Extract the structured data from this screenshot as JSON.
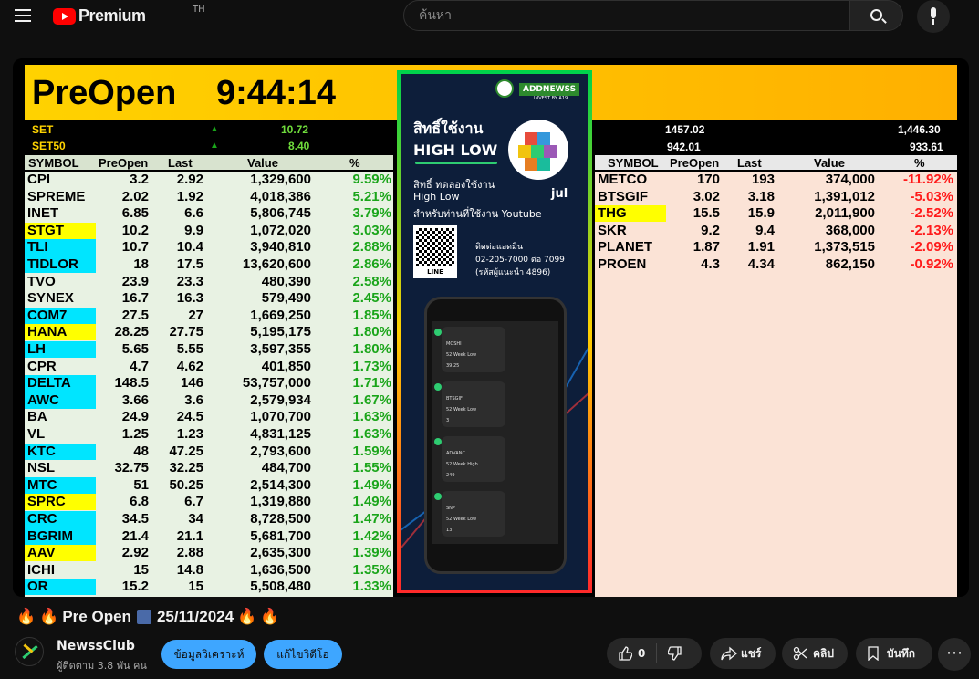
{
  "header": {
    "logo_text": "Premium",
    "logo_region": "TH",
    "search_placeholder": "ค้นหา"
  },
  "video": {
    "banner": {
      "title": "PreOpen",
      "time": "9:44:14"
    },
    "indices_left": [
      {
        "name": "SET",
        "value": "10.72"
      },
      {
        "name": "SET50",
        "value": "8.40"
      }
    ],
    "indices_right": [
      {
        "a": "1457.02",
        "b": "1,446.30"
      },
      {
        "a": "942.01",
        "b": "933.61"
      }
    ],
    "columns": [
      "SYMBOL",
      "PreOpen",
      "Last",
      "Value",
      "%"
    ],
    "gainers": [
      {
        "sym": "CPI",
        "po": "3.2",
        "last": "2.92",
        "val": "1,329,600",
        "pct": "9.59%",
        "hl": ""
      },
      {
        "sym": "SPREME",
        "po": "2.02",
        "last": "1.92",
        "val": "4,018,386",
        "pct": "5.21%",
        "hl": ""
      },
      {
        "sym": "INET",
        "po": "6.85",
        "last": "6.6",
        "val": "5,806,745",
        "pct": "3.79%",
        "hl": ""
      },
      {
        "sym": "STGT",
        "po": "10.2",
        "last": "9.9",
        "val": "1,072,020",
        "pct": "3.03%",
        "hl": "yellow"
      },
      {
        "sym": "TLI",
        "po": "10.7",
        "last": "10.4",
        "val": "3,940,810",
        "pct": "2.88%",
        "hl": "cyan"
      },
      {
        "sym": "TIDLOR",
        "po": "18",
        "last": "17.5",
        "val": "13,620,600",
        "pct": "2.86%",
        "hl": "cyan"
      },
      {
        "sym": "TVO",
        "po": "23.9",
        "last": "23.3",
        "val": "480,390",
        "pct": "2.58%",
        "hl": ""
      },
      {
        "sym": "SYNEX",
        "po": "16.7",
        "last": "16.3",
        "val": "579,490",
        "pct": "2.45%",
        "hl": ""
      },
      {
        "sym": "COM7",
        "po": "27.5",
        "last": "27",
        "val": "1,669,250",
        "pct": "1.85%",
        "hl": "cyan"
      },
      {
        "sym": "HANA",
        "po": "28.25",
        "last": "27.75",
        "val": "5,195,175",
        "pct": "1.80%",
        "hl": "yellow"
      },
      {
        "sym": "LH",
        "po": "5.65",
        "last": "5.55",
        "val": "3,597,355",
        "pct": "1.80%",
        "hl": "cyan"
      },
      {
        "sym": "CPR",
        "po": "4.7",
        "last": "4.62",
        "val": "401,850",
        "pct": "1.73%",
        "hl": ""
      },
      {
        "sym": "DELTA",
        "po": "148.5",
        "last": "146",
        "val": "53,757,000",
        "pct": "1.71%",
        "hl": "cyan"
      },
      {
        "sym": "AWC",
        "po": "3.66",
        "last": "3.6",
        "val": "2,579,934",
        "pct": "1.67%",
        "hl": "cyan"
      },
      {
        "sym": "BA",
        "po": "24.9",
        "last": "24.5",
        "val": "1,070,700",
        "pct": "1.63%",
        "hl": ""
      },
      {
        "sym": "VL",
        "po": "1.25",
        "last": "1.23",
        "val": "4,831,125",
        "pct": "1.63%",
        "hl": ""
      },
      {
        "sym": "KTC",
        "po": "48",
        "last": "47.25",
        "val": "2,793,600",
        "pct": "1.59%",
        "hl": "cyan"
      },
      {
        "sym": "NSL",
        "po": "32.75",
        "last": "32.25",
        "val": "484,700",
        "pct": "1.55%",
        "hl": ""
      },
      {
        "sym": "MTC",
        "po": "51",
        "last": "50.25",
        "val": "2,514,300",
        "pct": "1.49%",
        "hl": "cyan"
      },
      {
        "sym": "SPRC",
        "po": "6.8",
        "last": "6.7",
        "val": "1,319,880",
        "pct": "1.49%",
        "hl": "yellow"
      },
      {
        "sym": "CRC",
        "po": "34.5",
        "last": "34",
        "val": "8,728,500",
        "pct": "1.47%",
        "hl": "cyan"
      },
      {
        "sym": "BGRIM",
        "po": "21.4",
        "last": "21.1",
        "val": "5,681,700",
        "pct": "1.42%",
        "hl": "cyan"
      },
      {
        "sym": "AAV",
        "po": "2.92",
        "last": "2.88",
        "val": "2,635,300",
        "pct": "1.39%",
        "hl": "yellow"
      },
      {
        "sym": "ICHI",
        "po": "15",
        "last": "14.8",
        "val": "1,636,500",
        "pct": "1.35%",
        "hl": ""
      },
      {
        "sym": "OR",
        "po": "15.2",
        "last": "15",
        "val": "5,508,480",
        "pct": "1.33%",
        "hl": "cyan"
      }
    ],
    "losers": [
      {
        "sym": "METCO",
        "po": "170",
        "last": "193",
        "val": "374,000",
        "pct": "-11.92%",
        "hl": ""
      },
      {
        "sym": "BTSGIF",
        "po": "3.02",
        "last": "3.18",
        "val": "1,391,012",
        "pct": "-5.03%",
        "hl": ""
      },
      {
        "sym": "THG",
        "po": "15.5",
        "last": "15.9",
        "val": "2,011,900",
        "pct": "-2.52%",
        "hl": "yellow"
      },
      {
        "sym": "SKR",
        "po": "9.2",
        "last": "9.4",
        "val": "368,000",
        "pct": "-2.13%",
        "hl": ""
      },
      {
        "sym": "PLANET",
        "po": "1.87",
        "last": "1.91",
        "val": "1,373,515",
        "pct": "-2.09%",
        "hl": ""
      },
      {
        "sym": "PROEN",
        "po": "4.3",
        "last": "4.34",
        "val": "862,150",
        "pct": "-0.92%",
        "hl": ""
      }
    ],
    "ad": {
      "badge": "ADDNEWSS",
      "badge_sub": "INVEST BY A19",
      "h1": "สิทธิ์ใช้งาน",
      "h2": "HIGH LOW",
      "p1": "สิทธิ์ ทดลองใช้งาน",
      "p2": "High Low",
      "p3": "สำหรับท่านที่ใช้งาน Youtube",
      "jul": "jul",
      "qr_label": "LINE",
      "contact1": "ติดต่อแอดมิน",
      "contact2": "02-205-7000 ต่อ 7099",
      "contact3": "(รหัสผู้แนะนำ 4896)",
      "chats": [
        {
          "t1": "MOSHI",
          "t2": "52 Week Low",
          "t3": "39.25"
        },
        {
          "t1": "BTSGIF",
          "t2": "52 Week Low",
          "t3": "3"
        },
        {
          "t1": "ADVANC",
          "t2": "52 Week High",
          "t3": "249"
        },
        {
          "t1": "SNP",
          "t2": "52 Week Low",
          "t3": "13"
        }
      ]
    }
  },
  "details": {
    "title_text": "Pre Open",
    "title_date": "25/11/2024",
    "channel_name": "NewssClub",
    "channel_subs": "ผู้ติดตาม 3.8 พัน คน",
    "btn_analysis": "ข้อมูลวิเคราะห์",
    "btn_edit": "แก้ไขวิดีโอ",
    "likes": "0",
    "share": "แชร์",
    "clip": "คลิป",
    "save": "บันทึก",
    "more": "⋯"
  },
  "colors": {
    "up": "#1aa51a",
    "down": "#ff1a1a",
    "highlight_yellow": "#ffff00",
    "highlight_cyan": "#00e5ff",
    "accent": "#3ea6ff"
  }
}
